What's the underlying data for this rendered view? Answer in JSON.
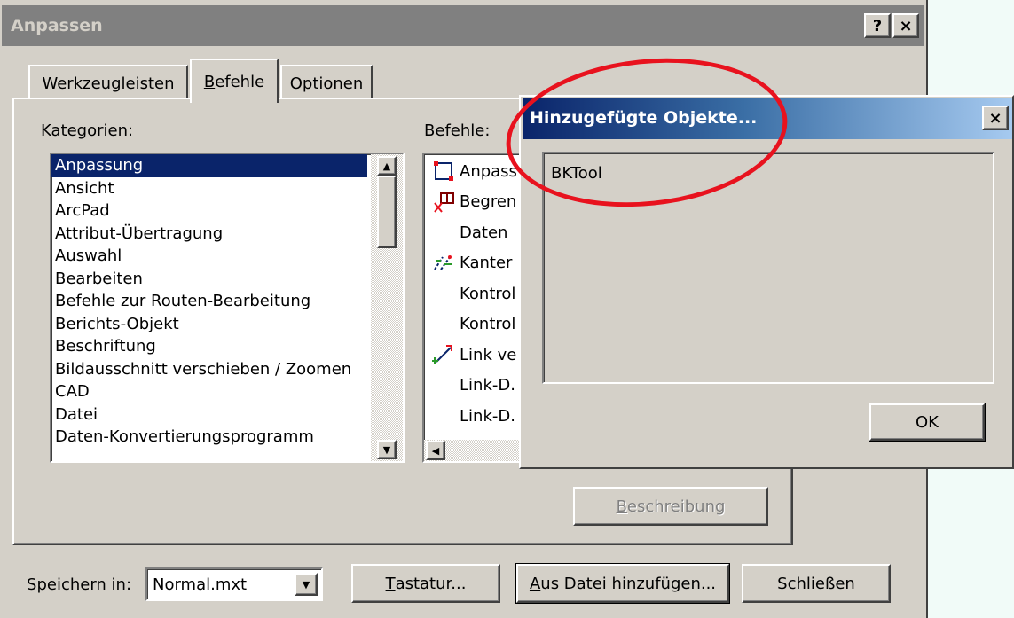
{
  "window": {
    "title": "Anpassen",
    "help_btn": "?",
    "close_btn": "×"
  },
  "tabs": [
    {
      "pre": "Wer",
      "key": "k",
      "post": "zeugleisten"
    },
    {
      "pre": "",
      "key": "B",
      "post": "efehle"
    },
    {
      "pre": "",
      "key": "O",
      "post": "ptionen"
    }
  ],
  "categories": {
    "label_key": "K",
    "label_rest": "ategorien:",
    "items": [
      "Anpassung",
      "Ansicht",
      "ArcPad",
      "Attribut-Übertragung",
      "Auswahl",
      "Bearbeiten",
      "Befehle zur Routen-Bearbeitung",
      "Berichts-Objekt",
      "Beschriftung",
      "Bildausschnitt verschieben / Zoomen",
      "CAD",
      "Datei",
      "Daten-Konvertierungsprogramm"
    ]
  },
  "commands": {
    "label_pre": "Be",
    "label_key": "f",
    "label_rest": "ehle:",
    "items": [
      {
        "icon": "rectangle-select-icon",
        "label": "Anpass"
      },
      {
        "icon": "clip-icon",
        "label": "Begren"
      },
      {
        "icon": "",
        "label": "Daten"
      },
      {
        "icon": "edges-icon",
        "label": "Kanter"
      },
      {
        "icon": "",
        "label": "Kontrol"
      },
      {
        "icon": "",
        "label": "Kontrol"
      },
      {
        "icon": "link-icon",
        "label": "Link ve"
      },
      {
        "icon": "",
        "label": "Link-D."
      },
      {
        "icon": "",
        "label": "Link-D."
      }
    ]
  },
  "description_btn": {
    "key": "B",
    "rest": "eschreibung"
  },
  "save_in": {
    "key": "S",
    "rest": "peichern in:",
    "value": "Normal.mxt"
  },
  "buttons": {
    "keyboard": {
      "key": "T",
      "rest": "astatur..."
    },
    "add_from_file": {
      "key": "A",
      "rest": "us Datei hinzufügen..."
    },
    "close": "Schließen"
  },
  "popup": {
    "title": "Hinzugefügte Objekte...",
    "close_btn": "×",
    "item": "BKTool",
    "ok": "OK"
  },
  "colors": {
    "highlight": "#0a246a",
    "annotation_oval": "#e8121e",
    "face": "#d4d0c8"
  }
}
